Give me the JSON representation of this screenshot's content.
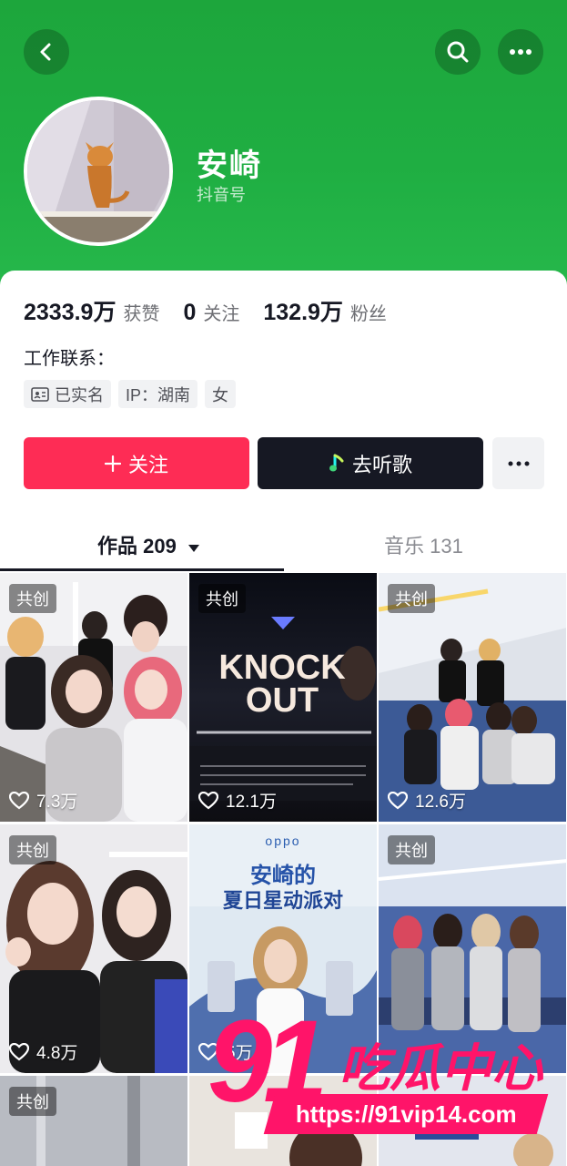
{
  "profile": {
    "name": "安崎",
    "id_label": "抖音号"
  },
  "stats": [
    {
      "value": "2333.9万",
      "label": "获赞"
    },
    {
      "value": "0",
      "label": "关注"
    },
    {
      "value": "132.9万",
      "label": "粉丝"
    }
  ],
  "contact_label": "工作联系：",
  "tags": {
    "verified": "已实名",
    "ip": "IP：湖南",
    "gender": "女"
  },
  "buttons": {
    "follow": "关注",
    "music": "去听歌"
  },
  "tabs": {
    "works": "作品 209",
    "music": "音乐 131"
  },
  "posts": [
    {
      "badge": "共创",
      "likes": "7.3万"
    },
    {
      "badge": "共创",
      "likes": "12.1万",
      "title": "KNOCK OUT"
    },
    {
      "badge": "共创",
      "likes": "12.6万"
    },
    {
      "badge": "共创",
      "likes": "4.8万"
    },
    {
      "badge": "",
      "likes": "5万",
      "brand": "oppo",
      "headline": "安崎的",
      "subline": "夏日星动派对"
    },
    {
      "badge": "共创",
      "likes": ""
    },
    {
      "badge": "共创",
      "likes": ""
    },
    {
      "badge": "",
      "likes": ""
    },
    {
      "badge": "",
      "likes": ""
    }
  ],
  "watermark": {
    "number": "91",
    "text": "吃瓜中心",
    "url": "https://91vip14.com"
  },
  "colors": {
    "header_green": "#1fae42",
    "follow_red": "#fe2c55",
    "dark": "#161823",
    "watermark_pink": "#ff1469"
  }
}
